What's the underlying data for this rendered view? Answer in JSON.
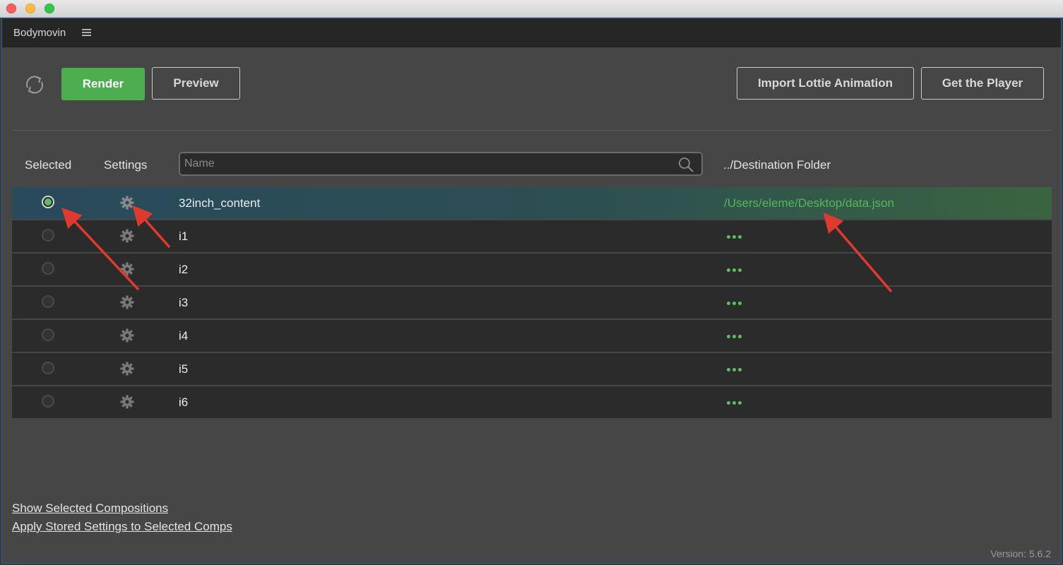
{
  "window": {
    "traffic_lights": [
      "close",
      "minimize",
      "maximize"
    ]
  },
  "panel": {
    "title": "Bodymovin",
    "menu_icon": "hamburger-menu-icon"
  },
  "toolbar": {
    "refresh_icon": "refresh-icon",
    "render_label": "Render",
    "preview_label": "Preview",
    "import_label": "Import Lottie Animation",
    "player_label": "Get the Player"
  },
  "columns": {
    "selected": "Selected",
    "settings": "Settings",
    "destination": "../Destination Folder"
  },
  "search": {
    "placeholder": "Name",
    "value": ""
  },
  "compositions": [
    {
      "name": "32inch_content",
      "selected": true,
      "destination": "/Users/eleme/Desktop/data.json"
    },
    {
      "name": "i1",
      "selected": false,
      "destination": "..."
    },
    {
      "name": "i2",
      "selected": false,
      "destination": "..."
    },
    {
      "name": "i3",
      "selected": false,
      "destination": "..."
    },
    {
      "name": "i4",
      "selected": false,
      "destination": "..."
    },
    {
      "name": "i5",
      "selected": false,
      "destination": "..."
    },
    {
      "name": "i6",
      "selected": false,
      "destination": "..."
    }
  ],
  "footer": {
    "show_selected": "Show Selected Compositions",
    "apply_settings": "Apply Stored Settings to Selected Comps",
    "version": "Version: 5.6.2"
  },
  "colors": {
    "accent_green": "#4cae4f",
    "annotation_arrow": "#e03a2f"
  }
}
